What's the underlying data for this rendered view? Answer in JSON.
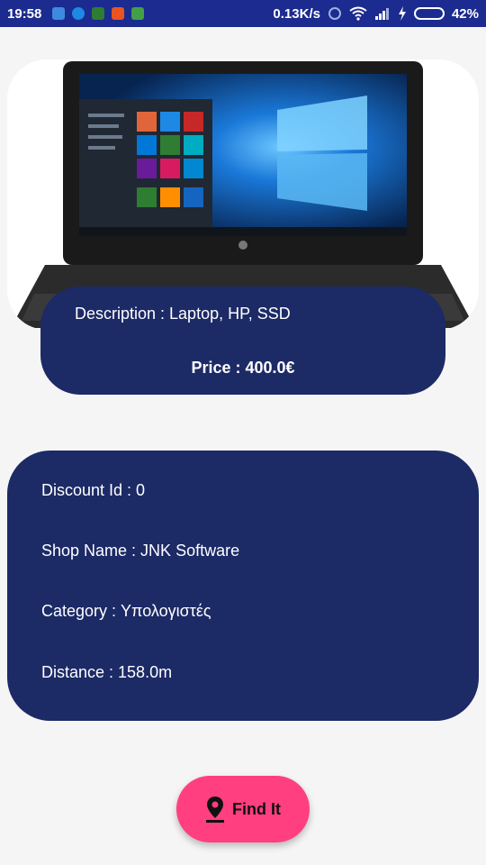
{
  "status_bar": {
    "time": "19:58",
    "network_speed": "0.13K/s",
    "battery_percent": "42%",
    "battery_level": 0.42
  },
  "product": {
    "description": "Description : Laptop, HP, SSD",
    "price": "Price : 400.0€"
  },
  "details": {
    "discount_id": "Discount Id : 0",
    "shop_name": "Shop Name : JNK Software",
    "category": "Category : Υπολογιστές",
    "distance": "Distance : 158.0m"
  },
  "actions": {
    "find_label": "Find It"
  },
  "colors": {
    "status_bar": "#1b2b8f",
    "card": "#1c2a66",
    "button": "#ff3f80"
  }
}
